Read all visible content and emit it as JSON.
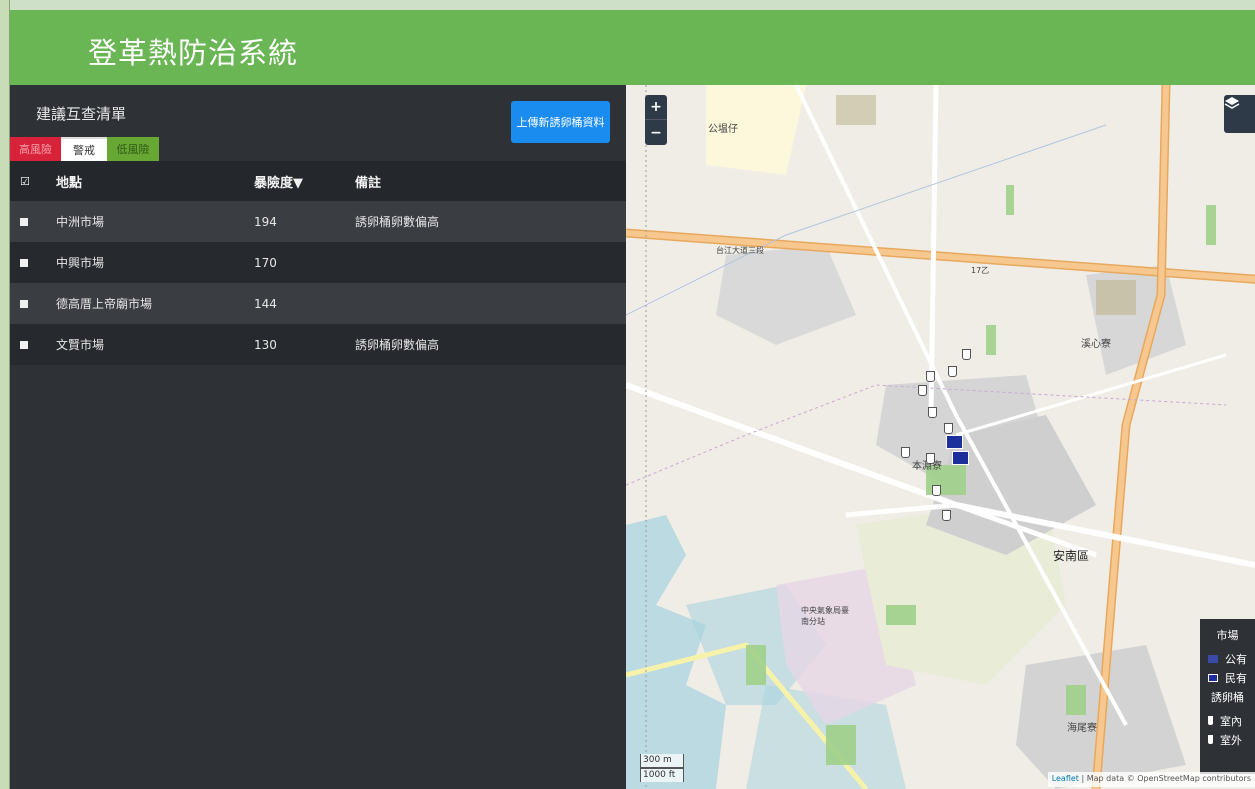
{
  "header": {
    "title": "登革熱防治系統"
  },
  "panel": {
    "title": "建議互查清單",
    "upload_button": "上傳新誘卵桶資料",
    "tabs": [
      {
        "label": "高風險"
      },
      {
        "label": "警戒"
      },
      {
        "label": "低風險"
      }
    ]
  },
  "table": {
    "headers": {
      "check": "☑",
      "location": "地點",
      "risk": "暴險度▼",
      "note": "備註"
    },
    "rows": [
      {
        "location": "中洲市場",
        "risk": "194",
        "note": "誘卵桶卵數偏高"
      },
      {
        "location": "中興市場",
        "risk": "170",
        "note": ""
      },
      {
        "location": "德高厝上帝廟市場",
        "risk": "144",
        "note": ""
      },
      {
        "location": "文賢市場",
        "risk": "130",
        "note": "誘卵桶卵數偏高"
      }
    ]
  },
  "map": {
    "zoom_in": "+",
    "zoom_out": "−",
    "scale_metric": "300 m",
    "scale_imperial": "1000 ft",
    "attribution_leaflet": "Leaflet",
    "attribution_text": " | Map data © OpenStreetMap contributors",
    "labels": {
      "district": "安南區",
      "haiwei": "海尾寮",
      "benyuan": "本淵寮",
      "xixin": "溪心寮",
      "gongliao": "公塭仔",
      "road_taijiang": "台江大道三段",
      "road_17": "17乙",
      "station": "中央氣象局臺南分站"
    },
    "legend": {
      "market_title": "市場",
      "public": "公有",
      "private": "民有",
      "trap_title": "誘卵桶",
      "indoor": "室內",
      "outdoor": "室外"
    }
  },
  "colors": {
    "header_green": "#6ab655",
    "high_risk": "#d8223a",
    "low_risk": "#67a835",
    "upload_blue": "#1a8cf0"
  }
}
